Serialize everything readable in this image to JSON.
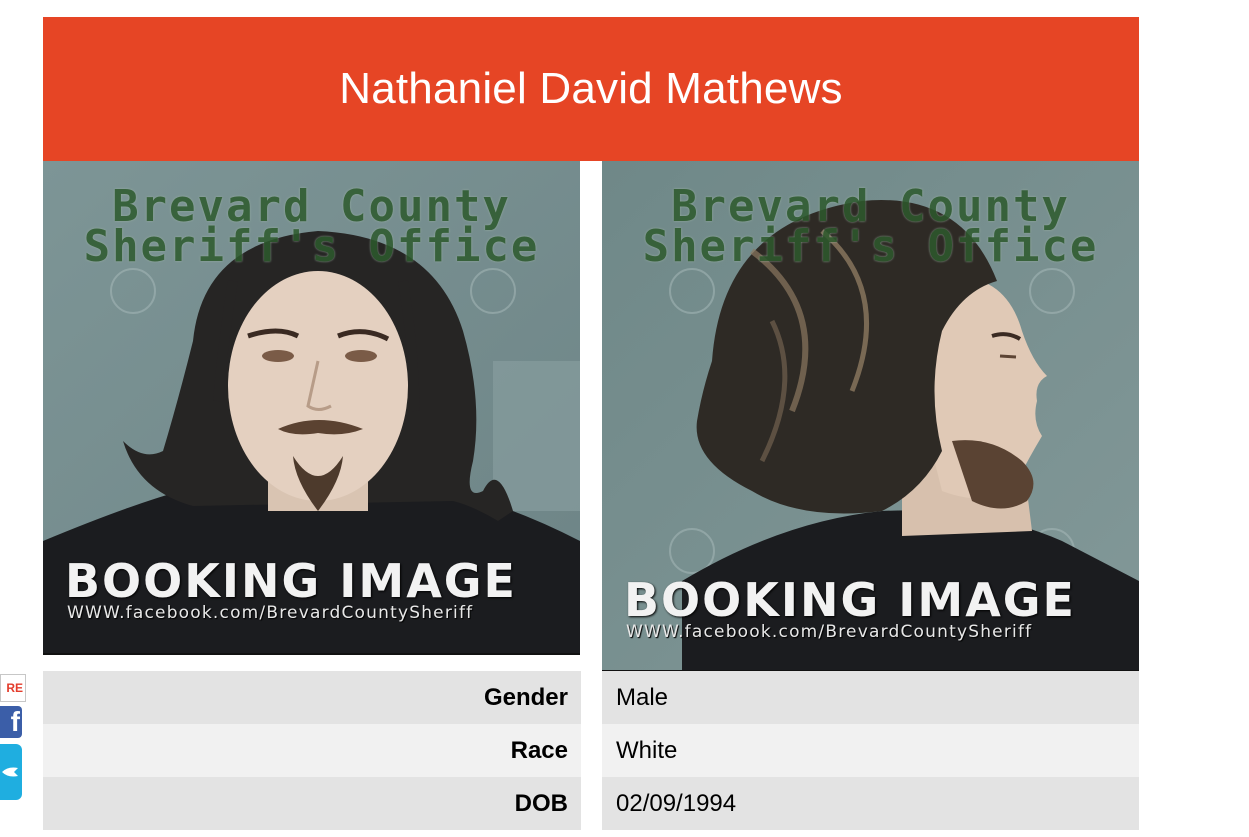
{
  "header": {
    "name": "Nathaniel David Mathews",
    "bg_color": "#e64525"
  },
  "photos": {
    "front": {
      "watermark_line1": "Brevard County",
      "watermark_line2": "Sheriff's Office",
      "booking_label": "BOOKING IMAGE",
      "booking_url": "WWW.facebook.com/BrevardCountySheriff"
    },
    "side": {
      "watermark_line1": "Brevard County",
      "watermark_line2": "Sheriff's Office",
      "booking_label": "BOOKING IMAGE",
      "booking_url": "WWW.facebook.com/BrevardCountySheriff"
    }
  },
  "details": {
    "rows": [
      {
        "label": "Gender",
        "value": "Male"
      },
      {
        "label": "Race",
        "value": "White"
      },
      {
        "label": "DOB",
        "value": "02/09/1994"
      }
    ]
  },
  "share": {
    "label": "RE",
    "facebook_glyph": "f",
    "icons": [
      "share-label-icon",
      "facebook-icon",
      "twitter-icon"
    ]
  }
}
